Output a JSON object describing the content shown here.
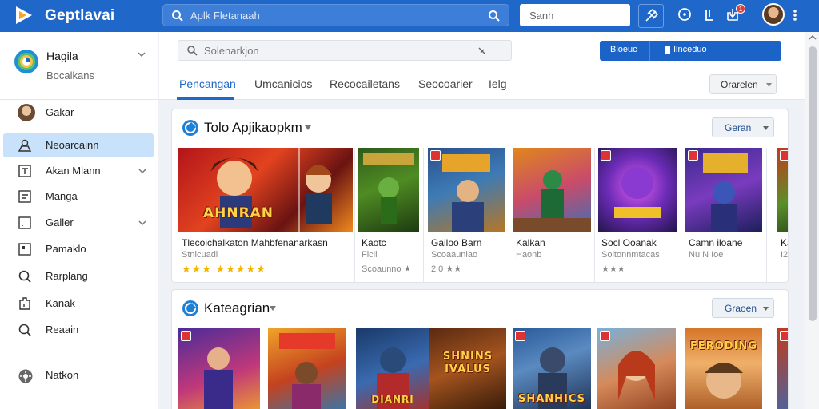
{
  "topbar": {
    "app_title": "Geptlavai",
    "search_placeholder": "Aplk Fletanaah",
    "sign_text": "Sanh",
    "notification_count": "1",
    "colors": {
      "bar": "#1f67c9",
      "accent": "#1f67c9"
    }
  },
  "sidebar": {
    "profile": {
      "name": "Hagila",
      "subtitle": "Bocalkans"
    },
    "items": [
      {
        "label": "Gakar",
        "icon": "avatar"
      },
      {
        "label": "Neoarcainn",
        "icon": "user-icon",
        "active": true
      },
      {
        "label": "Akan Mlann",
        "icon": "image-icon",
        "has_chevron": true
      },
      {
        "label": "Manga",
        "icon": "document-icon"
      },
      {
        "label": "Galler",
        "icon": "square-icon",
        "has_chevron": true
      },
      {
        "label": "Pamaklo",
        "icon": "note-icon"
      },
      {
        "label": "Rarplang",
        "icon": "search-icon"
      },
      {
        "label": "Kanak",
        "icon": "bookmark-icon"
      },
      {
        "label": "Reaain",
        "icon": "search-icon"
      },
      {
        "label": "Natkon",
        "icon": "settings-icon"
      }
    ]
  },
  "header": {
    "search_placeholder": "Solenarkjon",
    "blue_bar": {
      "left": "Bloeuc",
      "right": "Ilnceduo"
    },
    "tabs": [
      {
        "label": "Pencangan",
        "active": true
      },
      {
        "label": "Umcanicios"
      },
      {
        "label": "Recocailetans"
      },
      {
        "label": "Seocoarier"
      },
      {
        "label": "Ielg"
      }
    ],
    "filter_label": "Orarelen"
  },
  "section1": {
    "title": "Tolo Apjikaopkm",
    "button": "Geran",
    "tiles": [
      {
        "name": "Tlecoichalkaton  Mahbfenanarkasn",
        "sub": "Stnicuadl",
        "stars": "★★★   ★★★★★",
        "art_text": "AHNRAN"
      },
      {
        "name": "Kaotc",
        "sub": "Ficll",
        "rating": "Scoaunno ★"
      },
      {
        "name": "Gailoo Barn",
        "sub": "Scoaaunlao",
        "rating": "2 0 ★★"
      },
      {
        "name": "Kalkan",
        "sub": "Haonb"
      },
      {
        "name": "Socl Ooanak",
        "sub": "Soltonnmtacas",
        "rating": "★★★"
      },
      {
        "name": "Camn iloane",
        "sub": "Nu  N  Ioe"
      },
      {
        "name": "Ka",
        "sub": "I2"
      }
    ]
  },
  "section2": {
    "title": "Kateagrian",
    "button": "Graoen",
    "tiles": [
      {
        "art_text": ""
      },
      {
        "art_text": ""
      },
      {
        "art_text": "DIANRI"
      },
      {
        "art_text": "SHNINS IVALUS"
      },
      {
        "art_text": "SHANHICS"
      },
      {
        "art_text": ""
      },
      {
        "art_text": "FERODING"
      },
      {
        "art_text": ""
      }
    ]
  }
}
